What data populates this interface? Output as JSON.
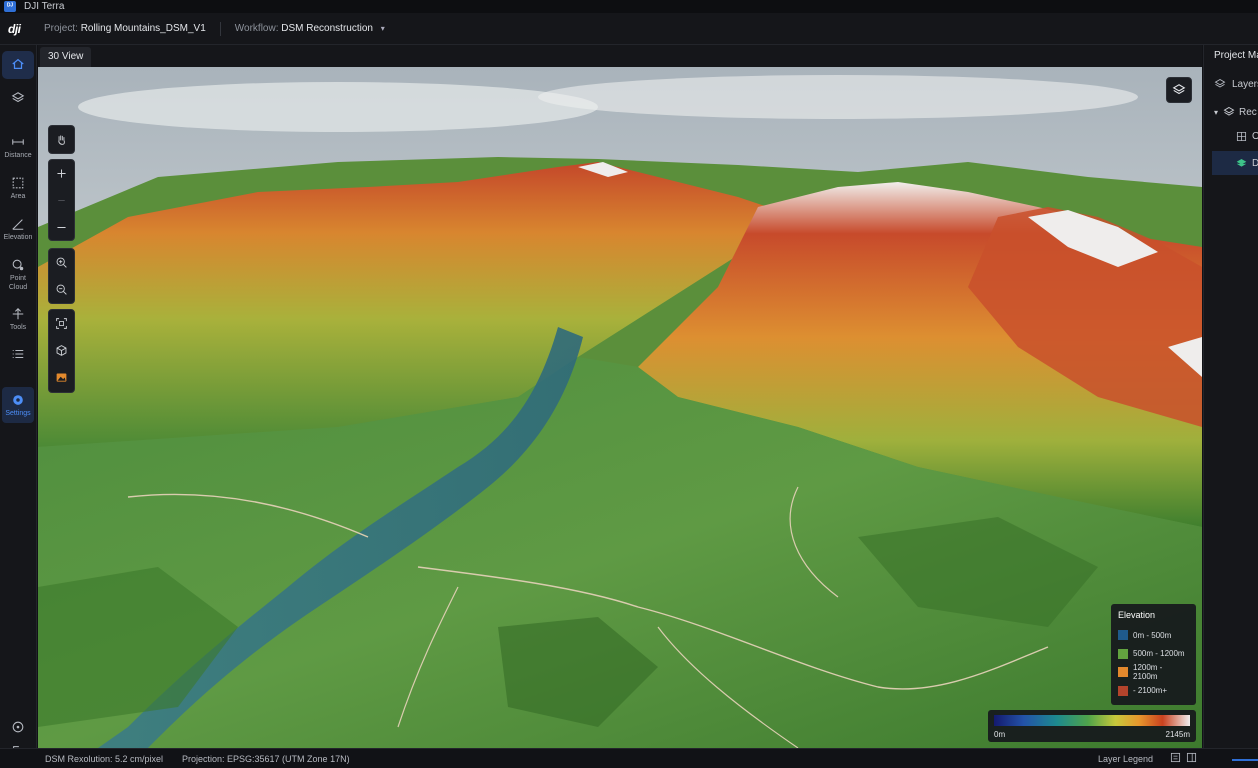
{
  "app": {
    "title": "DJI Terra",
    "logo": "dji"
  },
  "header": {
    "project_label": "Project:",
    "project_name": "Rolling Mountains_DSM_V1",
    "workflow_label": "Workflow:",
    "workflow_name": "DSM Reconstruction"
  },
  "sidebar": {
    "items": [
      {
        "icon": "home-icon",
        "label": ""
      },
      {
        "icon": "layers-icon",
        "label": ""
      },
      {
        "icon": "distance-icon",
        "label": "Distance"
      },
      {
        "icon": "area-icon",
        "label": "Area"
      },
      {
        "icon": "elevation-icon",
        "label": "Elevation"
      },
      {
        "icon": "point-cloud-icon",
        "label": "Point Cloud"
      },
      {
        "icon": "tools-icon",
        "label": "Tools"
      },
      {
        "icon": "list-icon",
        "label": ""
      },
      {
        "icon": "settings-icon",
        "label": "Settings"
      }
    ],
    "bottom": [
      {
        "icon": "info-icon"
      },
      {
        "icon": "logout-icon"
      }
    ]
  },
  "view": {
    "tab_label": "30 View"
  },
  "right_panel": {
    "title": "Project Ma",
    "layers_label": "Layers",
    "tree": [
      {
        "label": "Rec",
        "icon": "layers-icon"
      },
      {
        "label": "O",
        "icon": "grid-icon"
      },
      {
        "label": "D",
        "icon": "dsm-icon"
      }
    ]
  },
  "legend": {
    "title": "Elevation",
    "items": [
      {
        "label": "0m - 500m",
        "color": "#1f5a8c"
      },
      {
        "label": "500m - 1200m",
        "color": "#62a33f"
      },
      {
        "label": "1200m - 2100m",
        "color": "#e3892d"
      },
      {
        "label": "- 2100m+",
        "color": "#b3442c"
      }
    ]
  },
  "colorbar": {
    "min_label": "0m",
    "max_label": "2145m"
  },
  "status": {
    "resolution": "DSM Rexolution: 5.2 cm/pixel",
    "projection": "Projection: EPSG:35617 (UTM Zone 17N)",
    "layer_legend": "Layer Legend"
  }
}
